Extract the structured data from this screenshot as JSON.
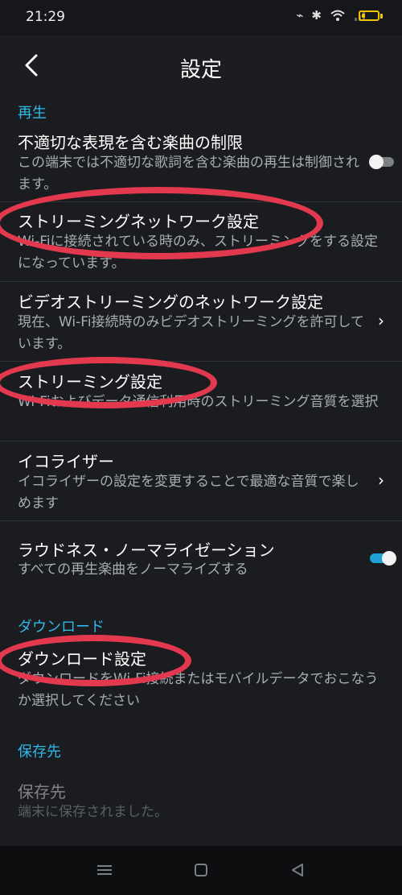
{
  "status": {
    "time": "21:29"
  },
  "header": {
    "title": "設定"
  },
  "sections": {
    "playback": "再生",
    "download": "ダウンロード",
    "storage": "保存先"
  },
  "items": {
    "explicit": {
      "title": "不適切な表現を含む楽曲の制限",
      "subtitle": "この端末では不適切な歌詞を含む楽曲の再生は制御されます。",
      "toggle_on": false
    },
    "streaming_network": {
      "title": "ストリーミングネットワーク設定",
      "subtitle": "Wi-Fiに接続されている時のみ、ストリーミングをする設定になっています。"
    },
    "video_network": {
      "title": "ビデオストリーミングのネットワーク設定",
      "subtitle": "現在、Wi-Fi接続時のみビデオストリーミングを許可しています。"
    },
    "streaming_quality": {
      "title": "ストリーミング設定",
      "subtitle": "Wi-Fiおよびデータ通信利用時のストリーミング音質を選択"
    },
    "equalizer": {
      "title": "イコライザー",
      "subtitle": "イコライザーの設定を変更することで最適な音質で楽しめます"
    },
    "loudness": {
      "title": "ラウドネス・ノーマライゼーション",
      "subtitle": "すべての再生楽曲をノーマライズする",
      "toggle_on": true
    },
    "download_settings": {
      "title": "ダウンロード設定",
      "subtitle": "ダウンロードをWi-Fi接続またはモバイルデータでおこなうか選択してください"
    },
    "storage_location": {
      "title": "保存先",
      "subtitle": "端末に保存されました。"
    }
  },
  "colors": {
    "accent": "#2fb8ea",
    "annotation": "#e3394f",
    "background": "#1a1c1f"
  }
}
